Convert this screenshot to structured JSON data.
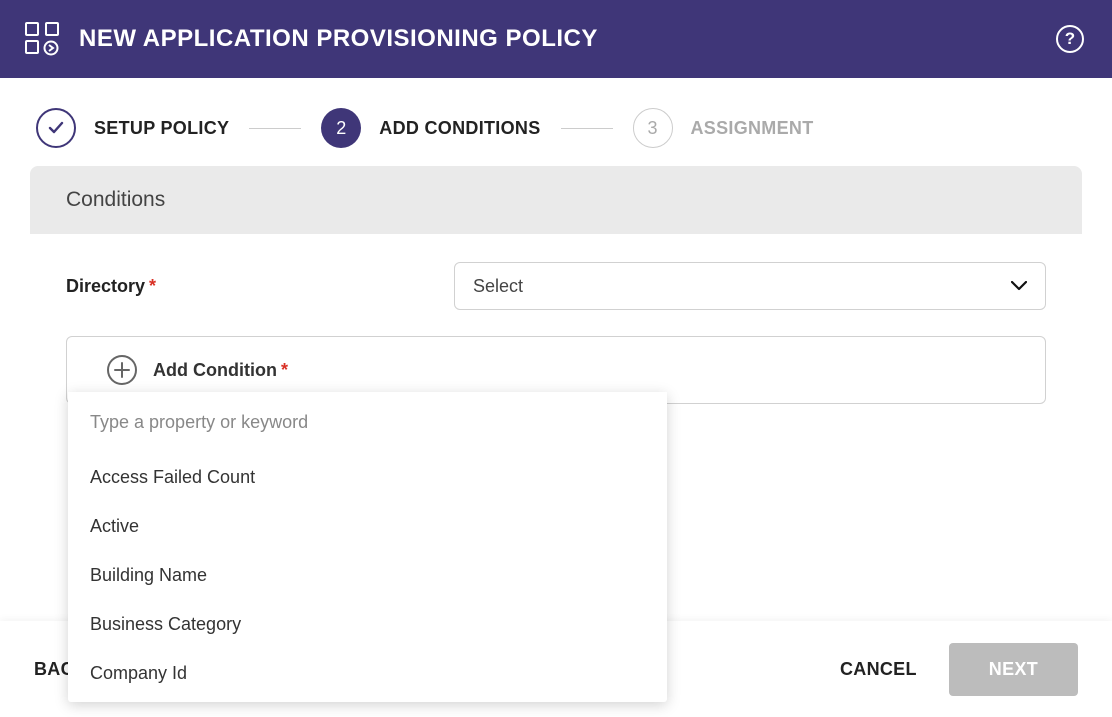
{
  "header": {
    "title": "NEW APPLICATION PROVISIONING POLICY"
  },
  "stepper": {
    "steps": [
      {
        "label": "SETUP POLICY",
        "indicator": "✓",
        "state": "done"
      },
      {
        "label": "ADD CONDITIONS",
        "indicator": "2",
        "state": "active"
      },
      {
        "label": "ASSIGNMENT",
        "indicator": "3",
        "state": "pending"
      }
    ]
  },
  "card": {
    "title": "Conditions",
    "directoryLabel": "Directory",
    "directoryValue": "Select",
    "addConditionLabel": "Add Condition"
  },
  "dropdown": {
    "placeholder": "Type a property or keyword",
    "items": [
      "Access Failed Count",
      "Active",
      "Building Name",
      "Business Category",
      "Company Id"
    ]
  },
  "footer": {
    "back": "BACK",
    "cancel": "CANCEL",
    "next": "NEXT"
  }
}
